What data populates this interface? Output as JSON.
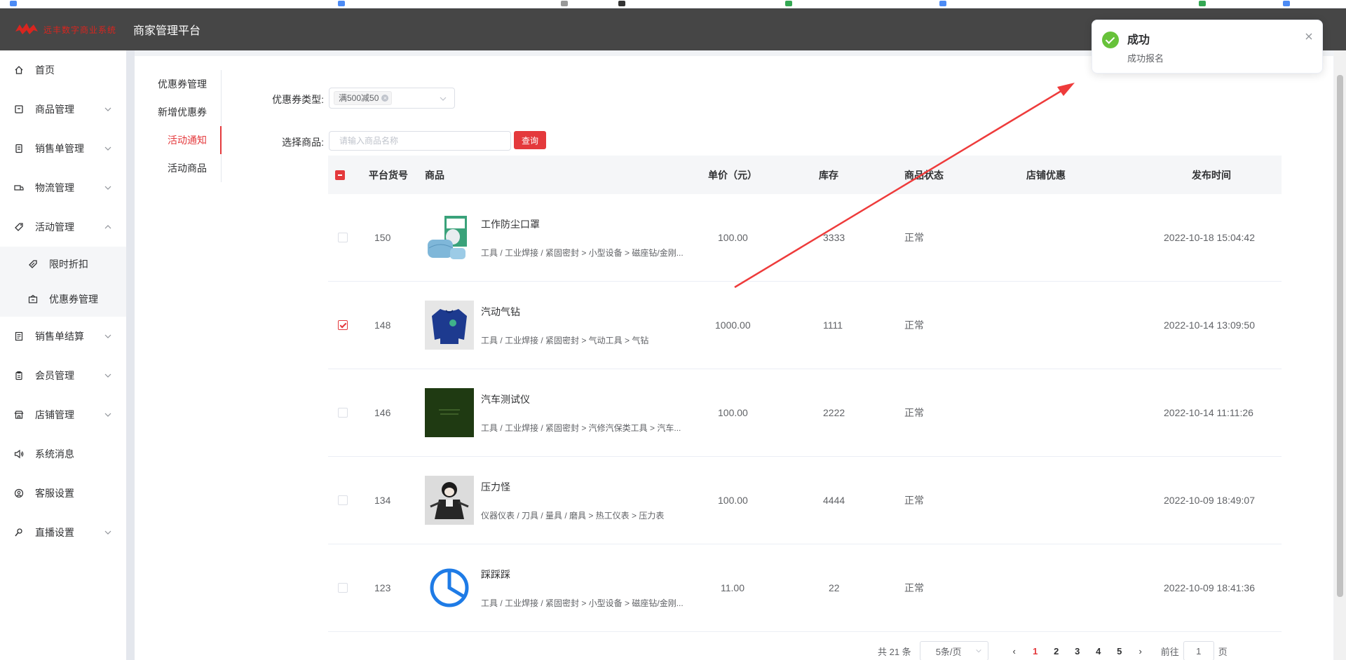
{
  "header": {
    "logo_text": "远丰数字商业系统",
    "platform_title": "商家管理平台"
  },
  "sidebar": {
    "items": [
      {
        "label": "首页",
        "icon": "home-icon"
      },
      {
        "label": "商品管理",
        "icon": "goods-icon"
      },
      {
        "label": "销售单管理",
        "icon": "order-icon"
      },
      {
        "label": "物流管理",
        "icon": "truck-icon"
      },
      {
        "label": "活动管理",
        "icon": "tag-icon"
      },
      {
        "label": "限时折扣",
        "icon": "discount-icon"
      },
      {
        "label": "优惠券管理",
        "icon": "coupon-icon"
      },
      {
        "label": "销售单结算",
        "icon": "settlement-icon"
      },
      {
        "label": "会员管理",
        "icon": "member-icon"
      },
      {
        "label": "店铺管理",
        "icon": "shop-icon"
      },
      {
        "label": "系统消息",
        "icon": "speaker-icon"
      },
      {
        "label": "客服设置",
        "icon": "service-icon"
      },
      {
        "label": "直播设置",
        "icon": "live-icon"
      }
    ]
  },
  "subtabs": [
    "优惠券管理",
    "新增优惠券",
    "活动通知",
    "活动商品"
  ],
  "form": {
    "coupon_type_label": "优惠券类型:",
    "coupon_type_tag": "满500减50",
    "select_goods_label": "选择商品:",
    "search_placeholder": "请输入商品名称",
    "query_button": "查询"
  },
  "table": {
    "headers": [
      "平台货号",
      "商品",
      "单价（元）",
      "库存",
      "商品状态",
      "店铺优惠",
      "发布时间"
    ],
    "rows": [
      {
        "checked": false,
        "id": "150",
        "name": "工作防尘口罩",
        "category": "工具 / 工业焊接 / 紧固密封 > 小型设备 > 磁座钻/金刚...",
        "price": "100.00",
        "stock": "3333",
        "status": "正常",
        "shop_discount": "",
        "time": "2022-10-18 15:04:42",
        "thumb": "mask-photo"
      },
      {
        "checked": true,
        "id": "148",
        "name": "汽动气钻",
        "category": "工具 / 工业焊接 / 紧固密封 > 气动工具 > 气钻",
        "price": "1000.00",
        "stock": "1111",
        "status": "正常",
        "shop_discount": "",
        "time": "2022-10-14 13:09:50",
        "thumb": "sweater-photo"
      },
      {
        "checked": false,
        "id": "146",
        "name": "汽车测试仪",
        "category": "工具 / 工业焊接 / 紧固密封 > 汽修汽保类工具 > 汽车...",
        "price": "100.00",
        "stock": "2222",
        "status": "正常",
        "shop_discount": "",
        "time": "2022-10-14 11:11:26",
        "thumb": "dark-green-photo"
      },
      {
        "checked": false,
        "id": "134",
        "name": "压力怪",
        "category": "仪器仪表 / 刀具 / 量具 / 磨具 > 热工仪表 > 压力表",
        "price": "100.00",
        "stock": "4444",
        "status": "正常",
        "shop_discount": "",
        "time": "2022-10-09 18:49:07",
        "thumb": "character-photo"
      },
      {
        "checked": false,
        "id": "123",
        "name": "踩踩踩",
        "category": "工具 / 工业焊接 / 紧固密封 > 小型设备 > 磁座钻/金刚...",
        "price": "11.00",
        "stock": "22",
        "status": "正常",
        "shop_discount": "",
        "time": "2022-10-09 18:41:36",
        "thumb": "pie-chart-icon"
      }
    ]
  },
  "pagination": {
    "total": "共 21 条",
    "page_size": "5条/页",
    "pages": [
      "1",
      "2",
      "3",
      "4",
      "5"
    ],
    "current": "1",
    "jump_prefix": "前往",
    "jump_value": "1",
    "jump_suffix": "页"
  },
  "notification": {
    "title": "成功",
    "message": "成功报名"
  },
  "colors": {
    "accent": "#e4393c",
    "header_bg": "#464646",
    "success": "#67c23a"
  }
}
